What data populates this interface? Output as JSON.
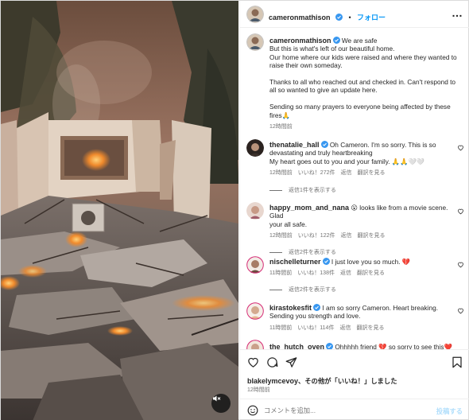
{
  "post": {
    "author": "cameronmathison",
    "follow_label": "フォロー",
    "more_label": "…",
    "caption_lines": [
      "We are safe",
      "But this is what's left of our beautiful home.",
      "Our home where our kids were raised and where they wanted to",
      "raise their own someday.",
      "",
      "Thanks to all who reached out and checked in. Can't respond to",
      "all so wanted to give an update here.",
      "",
      "Sending so many prayers to everyone being affected by these",
      "fires🙏"
    ],
    "caption_time": "12時間前"
  },
  "comments": [
    {
      "user": "thenatalie_hall",
      "verified": true,
      "lines": [
        "Oh Cameron. I'm so sorry. This is so",
        "devastating and truly heartbreaking",
        "My heart goes out to you and your family. 🙏🙏🤍🤍"
      ],
      "time": "12時間前",
      "likes": "いいね！272件",
      "reply": "返信",
      "translate": "翻訳を見る",
      "replies": "返信1件を表示する"
    },
    {
      "user": "happy_mom_and_nana",
      "verified": false,
      "lines": [
        "😮 looks like from a movie scene. Glad",
        "your all safe."
      ],
      "time": "12時間前",
      "likes": "いいね！122件",
      "reply": "返信",
      "translate": "翻訳を見る",
      "replies": "返信2件を表示する"
    },
    {
      "user": "nischelleturner",
      "verified": true,
      "lines": [
        "I just love you so much. 💔"
      ],
      "time": "11時間前",
      "likes": "いいね！138件",
      "reply": "返信",
      "translate": "翻訳を見る",
      "replies": "返信2件を表示する"
    },
    {
      "user": "kirastokesfit",
      "verified": true,
      "lines": [
        "I am so sorry Cameron. Heart breaking.",
        "Sending you strength and love."
      ],
      "time": "11時間前",
      "likes": "いいね！114件",
      "reply": "返信",
      "translate": "翻訳を見る",
      "replies": ""
    },
    {
      "user": "the_hutch_oven",
      "verified": true,
      "lines": [
        "Ohhhhh friend 💔 so sorry to see this❤️🙏"
      ],
      "time": "",
      "likes": "",
      "reply": "",
      "translate": "",
      "replies": ""
    }
  ],
  "likes_line": {
    "user": "blakelymcevoy",
    "rest": "、その他が「いいね！」しました",
    "time": "12時間前"
  },
  "comment_box": {
    "placeholder": "コメントを追加...",
    "post_label": "投稿する"
  },
  "colors": {
    "accent": "#0095f6",
    "verified": "#3897f0",
    "heart_red": "#ed4956"
  }
}
